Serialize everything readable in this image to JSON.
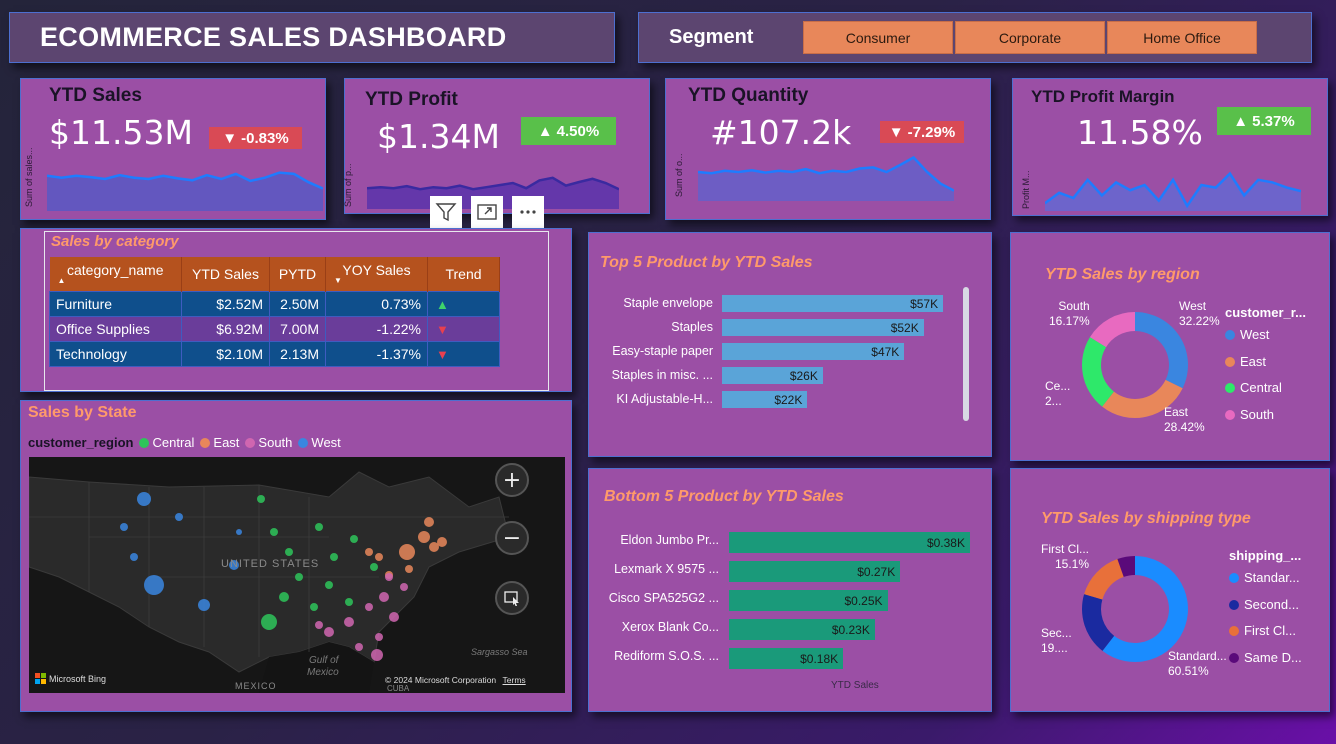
{
  "header": {
    "title": "ECOMMERCE SALES DASHBOARD"
  },
  "segment": {
    "label": "Segment",
    "options": [
      "Consumer",
      "Corporate",
      "Home Office"
    ]
  },
  "kpis": {
    "sales": {
      "label": "YTD Sales",
      "value": "$11.53M",
      "change": "-0.83%",
      "axis": "Sum of sales...",
      "trend": [
        0.55,
        0.52,
        0.55,
        0.53,
        0.5,
        0.56,
        0.52,
        0.5,
        0.55,
        0.51,
        0.48,
        0.56,
        0.5,
        0.58,
        0.47,
        0.52,
        0.6,
        0.58,
        0.45,
        0.35
      ]
    },
    "profit": {
      "label": "YTD Profit",
      "value": "$1.34M",
      "change": "4.50%",
      "axis": "Sum of p...",
      "trend": [
        0.4,
        0.42,
        0.4,
        0.44,
        0.38,
        0.42,
        0.4,
        0.45,
        0.38,
        0.42,
        0.46,
        0.5,
        0.4,
        0.55,
        0.6,
        0.45,
        0.52,
        0.58,
        0.5,
        0.38
      ]
    },
    "quantity": {
      "label": "YTD Quantity",
      "value": "#107.2k",
      "change": "-7.29%",
      "axis": "Sum of o...",
      "trend": [
        0.5,
        0.48,
        0.52,
        0.5,
        0.53,
        0.49,
        0.52,
        0.5,
        0.55,
        0.48,
        0.52,
        0.5,
        0.56,
        0.58,
        0.5,
        0.62,
        0.75,
        0.5,
        0.3,
        0.18
      ]
    },
    "margin": {
      "label": "YTD Profit Margin",
      "value": "11.58%",
      "change": "5.37%",
      "axis": "Profit M...",
      "trend": [
        0.15,
        0.35,
        0.25,
        0.6,
        0.3,
        0.55,
        0.4,
        0.5,
        0.2,
        0.6,
        0.1,
        0.5,
        0.45,
        0.72,
        0.3,
        0.6,
        0.55,
        0.45,
        0.38
      ]
    }
  },
  "category": {
    "title": "Sales by category",
    "columns": [
      "category_name",
      "YTD Sales",
      "PYTD",
      "YOY Sales",
      "Trend"
    ],
    "rows": [
      {
        "name": "Furniture",
        "ytd": "$2.52M",
        "pytd": "2.50M",
        "yoy": "0.73%",
        "trend": "up"
      },
      {
        "name": "Office Supplies",
        "ytd": "$6.92M",
        "pytd": "7.00M",
        "yoy": "-1.22%",
        "trend": "down"
      },
      {
        "name": "Technology",
        "ytd": "$2.10M",
        "pytd": "2.13M",
        "yoy": "-1.37%",
        "trend": "down"
      }
    ],
    "trend_up_color": "#3fd46a",
    "trend_down_color": "#e8404f"
  },
  "map": {
    "title": "Sales by State",
    "legend_title": "customer_region",
    "legend": [
      {
        "name": "Central",
        "color": "#2ec45a"
      },
      {
        "name": "East",
        "color": "#e8875a"
      },
      {
        "name": "South",
        "color": "#d066b0"
      },
      {
        "name": "West",
        "color": "#3a86e0"
      }
    ],
    "labels": {
      "country": "UNITED STATES",
      "gulf": "Gulf of Mexico",
      "gulf_line1": "Gulf of",
      "gulf_line2": "Mexico",
      "sea": "Sargasso Sea",
      "mexico": "MEXICO",
      "cuba": "CUBA",
      "bing": "Microsoft Bing",
      "copyright": "© 2024 Microsoft Corporation",
      "terms": "Terms"
    }
  },
  "top5": {
    "title": "Top 5 Product by YTD Sales",
    "items": [
      {
        "name": "Staple envelope",
        "value": 57,
        "label": "$57K"
      },
      {
        "name": "Staples",
        "value": 52,
        "label": "$52K"
      },
      {
        "name": "Easy-staple paper",
        "value": 47,
        "label": "$47K"
      },
      {
        "name": "Staples in misc. ...",
        "value": 26,
        "label": "$26K"
      },
      {
        "name": "KI Adjustable-H...",
        "value": 22,
        "label": "$22K"
      }
    ],
    "max": 58
  },
  "bottom5": {
    "title": "Bottom 5 Product by YTD Sales",
    "xlabel": "YTD Sales",
    "items": [
      {
        "name": "Eldon Jumbo Pr...",
        "value": 0.38,
        "label": "$0.38K"
      },
      {
        "name": "Lexmark X 9575 ...",
        "value": 0.27,
        "label": "$0.27K"
      },
      {
        "name": "Cisco SPA525G2 ...",
        "value": 0.25,
        "label": "$0.25K"
      },
      {
        "name": "Xerox Blank Co...",
        "value": 0.23,
        "label": "$0.23K"
      },
      {
        "name": "Rediform S.O.S. ...",
        "value": 0.18,
        "label": "$0.18K"
      }
    ],
    "max": 0.38
  },
  "region": {
    "title": "YTD Sales by region",
    "legend_title": "customer_r...",
    "slices": [
      {
        "name": "West",
        "pct": 32.22,
        "color": "#3a86e0"
      },
      {
        "name": "East",
        "pct": 28.42,
        "color": "#e8875a"
      },
      {
        "name": "Central",
        "pct": 23.19,
        "color": "#2ee86a"
      },
      {
        "name": "South",
        "pct": 16.17,
        "color": "#e86ac0"
      }
    ],
    "labels": {
      "west": [
        "West",
        "32.22%"
      ],
      "east": [
        "East",
        "28.42%"
      ],
      "central": [
        "Ce...",
        "2..."
      ],
      "south": [
        "South",
        "16.17%"
      ]
    }
  },
  "shipping": {
    "title": "YTD Sales by shipping type",
    "legend_title": "shipping_...",
    "legend": [
      "Standar...",
      "Second...",
      "First Cl...",
      "Same D..."
    ],
    "slices": [
      {
        "name": "Standard",
        "pct": 60.51,
        "color": "#1a8cff"
      },
      {
        "name": "Second",
        "pct": 19.0,
        "color": "#1a2aa0"
      },
      {
        "name": "First Class",
        "pct": 15.1,
        "color": "#e8703a"
      },
      {
        "name": "Same Day",
        "pct": 5.39,
        "color": "#5a0a7a"
      }
    ],
    "labels": {
      "standard": [
        "Standard...",
        "60.51%"
      ],
      "second": [
        "Sec...",
        "19...."
      ],
      "first": [
        "First Cl...",
        "15.1%"
      ]
    }
  }
}
